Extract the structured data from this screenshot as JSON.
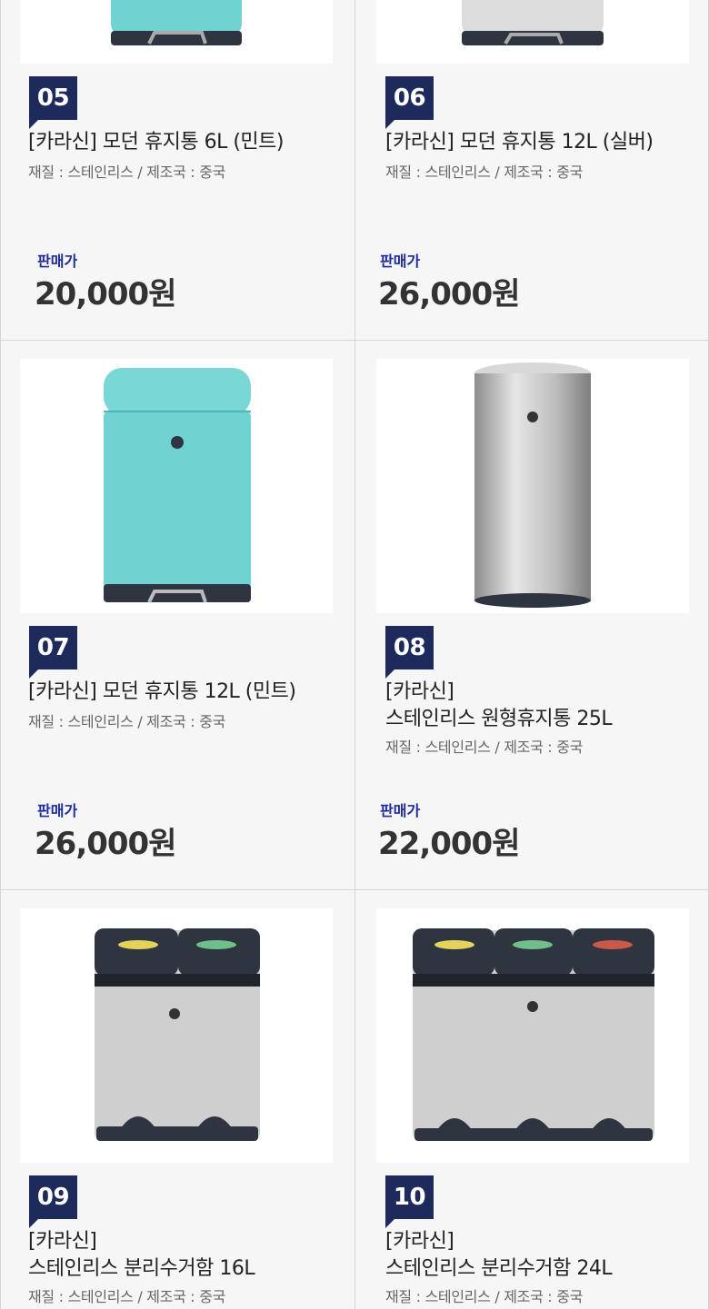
{
  "price_label": "판매가",
  "products": [
    {
      "no": "05",
      "title": "[카라신] 모던 휴지통 6L (민트)",
      "title2": "",
      "spec": "재질 : 스테인리스 / 제조국 : 중국",
      "price": "20,000원"
    },
    {
      "no": "06",
      "title": "[카라신] 모던 휴지통 12L (실버)",
      "title2": "",
      "spec": "재질 : 스테인리스 / 제조국 : 중국",
      "price": "26,000원"
    },
    {
      "no": "07",
      "title": "[카라신] 모던 휴지통 12L (민트)",
      "title2": "",
      "spec": "재질 : 스테인리스 / 제조국 : 중국",
      "price": "26,000원"
    },
    {
      "no": "08",
      "title": "[카라신]",
      "title2": "스테인리스 원형휴지통 25L",
      "spec": "재질 : 스테인리스 / 제조국 : 중국",
      "price": "22,000원"
    },
    {
      "no": "09",
      "title": "[카라신]",
      "title2": "스테인리스 분리수거함 16L",
      "spec": "재질 : 스테인리스 / 제조국 : 중국",
      "price": ""
    },
    {
      "no": "10",
      "title": "[카라신]",
      "title2": "스테인리스 분리수거함 24L",
      "spec": "재질 : 스테인리스 / 제조국 : 중국",
      "price": ""
    }
  ],
  "colors": {
    "badge": "#1f2a5c",
    "price_label": "#1f2a9c",
    "mint": "#6fd3d1",
    "steel": "#c9c9c9"
  }
}
